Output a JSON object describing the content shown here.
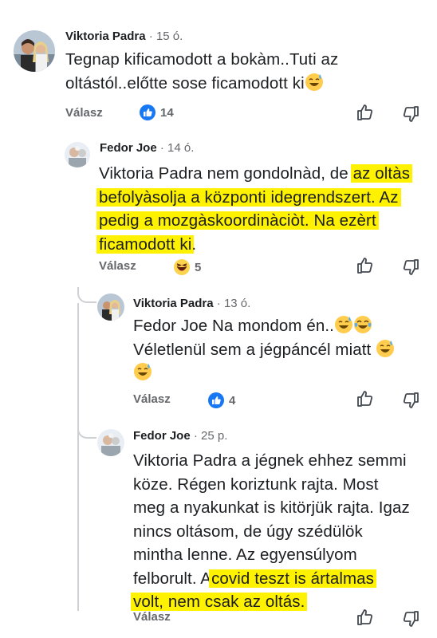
{
  "comments": [
    {
      "author": "Viktoria Padra",
      "time": "· 15 ó.",
      "lines": [
        "Tegnap kificamodott a bokàm..Tuti az",
        "oltástól..előtte sose ficamodott ki"
      ],
      "reply_label": "Válasz",
      "reaction": "like",
      "reaction_count": "14"
    },
    {
      "author": "Fedor Joe",
      "time": "· 14 ó.",
      "lines": [
        {
          "pre": "Viktoria Padra nem gondolnàd, de ",
          "hl": "az oltàs"
        },
        {
          "pre": "",
          "hl": "befolyàsolja a központi idegrendszert. Az"
        },
        {
          "pre": "",
          "hl": "pedig a mozgàskoordinàciòt. Na ezèrt"
        },
        {
          "pre": "",
          "hl": "ficamodott ki",
          "post": "."
        }
      ],
      "reply_label": "Válasz",
      "reaction": "haha",
      "reaction_count": "5"
    },
    {
      "author": "Viktoria Padra",
      "time": "· 13 ó.",
      "lines": [
        "Fedor Joe Na mondom én..",
        "Véletlenül sem a jégpáncél miatt",
        ""
      ],
      "reply_label": "Válasz",
      "reaction": "like",
      "reaction_count": "4"
    },
    {
      "author": "Fedor Joe",
      "time": "· 25 p.",
      "lines": [
        "Viktoria Padra a jégnek ehhez semmi",
        "köze. Régen koriztunk rajta. Most",
        "meg a nyakunkat is kitörjük rajta. Igaz",
        "nincs oltásom, de úgy szédülök",
        "mintha lenne. Az egyensúlyom",
        {
          "pre": "felborult. A",
          "hl": "covid teszt is ártalmas"
        },
        {
          "pre": "",
          "hl": "volt, nem csak az oltás."
        }
      ],
      "reply_label": "Válasz"
    }
  ],
  "colors": {
    "highlight": "#fff200",
    "like_blue": "#1877f2",
    "meta_gray": "#65676b"
  }
}
